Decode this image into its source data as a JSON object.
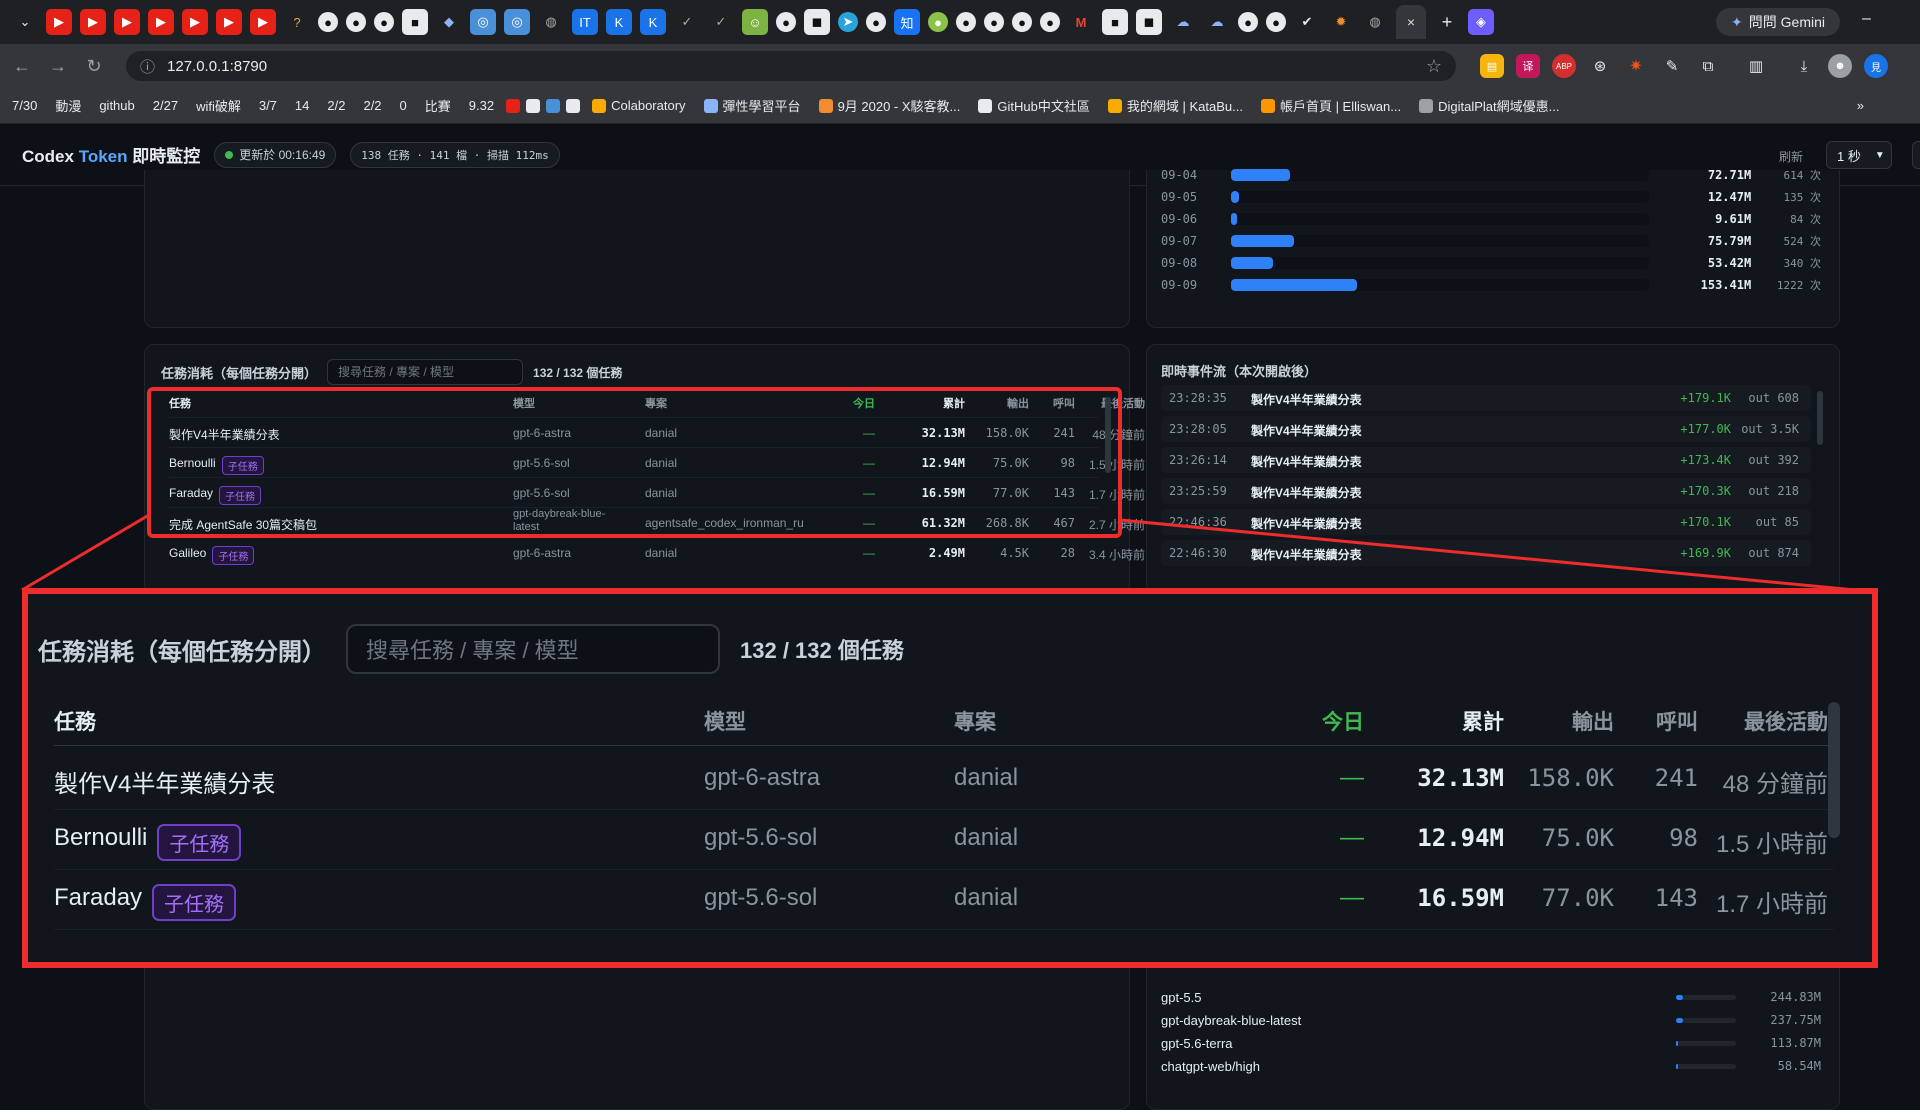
{
  "browser": {
    "url": "127.0.0.1:8790",
    "gemini_label": "問問 Gemini",
    "tab_close": "×",
    "new_tab": "+",
    "minimize": "–",
    "bookmarks": [
      "7/30",
      "動漫",
      "github",
      "2/27",
      "wifi破解",
      "3/7",
      "14",
      "2/2",
      "2/2",
      "0",
      "比賽",
      "9.32",
      "Colaboratory",
      "彈性學習平台",
      "9月 2020 - X駭客教...",
      "GitHub中文社區",
      "我的網域 | KataBu...",
      "帳戶首頁 | Elliswan...",
      "DigitalPlat網域優惠..."
    ],
    "bookmarks_more": "»"
  },
  "header": {
    "title_prefix": "Codex",
    "title_accent": "Token",
    "title_suffix": "即時監控",
    "updated": "更新於 00:16:49",
    "stats": "138 任務 · 141 檔 · 掃描 112ms",
    "refresh_label": "刷新",
    "refresh_value": "1 秒"
  },
  "daily": [
    {
      "date": "09-04",
      "value": "72.71M",
      "calls": "614 次",
      "frac": 0.14
    },
    {
      "date": "09-05",
      "value": "12.47M",
      "calls": "135 次",
      "frac": 0.02
    },
    {
      "date": "09-06",
      "value": "9.61M",
      "calls": "84 次",
      "frac": 0.015
    },
    {
      "date": "09-07",
      "value": "75.79M",
      "calls": "524 次",
      "frac": 0.15
    },
    {
      "date": "09-08",
      "value": "53.42M",
      "calls": "340 次",
      "frac": 0.1
    },
    {
      "date": "09-09",
      "value": "153.41M",
      "calls": "1222 次",
      "frac": 0.3
    }
  ],
  "tasks": {
    "title": "任務消耗（每個任務分開）",
    "search_placeholder": "搜尋任務 / 專案 / 模型",
    "count": "132 / 132 個任務",
    "headers": {
      "task": "任務",
      "model": "模型",
      "project": "專案",
      "today": "今日",
      "total": "累計",
      "output": "輸出",
      "calls": "呼叫",
      "last": "最後活動"
    },
    "rows": [
      {
        "task": "製作V4半年業績分表",
        "badge": "",
        "model": "gpt-6-astra",
        "project": "danial",
        "today": "—",
        "total": "32.13M",
        "output": "158.0K",
        "calls": "241",
        "last": "48 分鐘前"
      },
      {
        "task": "Bernoulli",
        "badge": "子任務",
        "model": "gpt-5.6-sol",
        "project": "danial",
        "today": "—",
        "total": "12.94M",
        "output": "75.0K",
        "calls": "98",
        "last": "1.5 小時前"
      },
      {
        "task": "Faraday",
        "badge": "子任務",
        "model": "gpt-5.6-sol",
        "project": "danial",
        "today": "—",
        "total": "16.59M",
        "output": "77.0K",
        "calls": "143",
        "last": "1.7 小時前"
      },
      {
        "task": "完成 AgentSafe 30篇交稿包",
        "badge": "",
        "model": "gpt-daybreak-blue-latest",
        "project": "agentsafe_codex_ironman_ru",
        "today": "—",
        "total": "61.32M",
        "output": "268.8K",
        "calls": "467",
        "last": "2.7 小時前"
      },
      {
        "task": "Galileo",
        "badge": "子任務",
        "model": "gpt-6-astra",
        "project": "danial",
        "today": "—",
        "total": "2.49M",
        "output": "4.5K",
        "calls": "28",
        "last": "3.4 小時前"
      }
    ]
  },
  "events": {
    "title": "即時事件流（本次開啟後）",
    "rows": [
      {
        "time": "23:28:35",
        "name": "製作V4半年業績分表",
        "delta": "+179.1K",
        "out": "out 608"
      },
      {
        "time": "23:28:05",
        "name": "製作V4半年業績分表",
        "delta": "+177.0K",
        "out": "out 3.5K"
      },
      {
        "time": "23:26:14",
        "name": "製作V4半年業績分表",
        "delta": "+173.4K",
        "out": "out 392"
      },
      {
        "time": "23:25:59",
        "name": "製作V4半年業績分表",
        "delta": "+170.3K",
        "out": "out 218"
      },
      {
        "time": "22:46:36",
        "name": "製作V4半年業績分表",
        "delta": "+170.1K",
        "out": "out 85"
      },
      {
        "time": "22:46:30",
        "name": "製作V4半年業績分表",
        "delta": "+169.9K",
        "out": "out 874"
      }
    ]
  },
  "models": [
    {
      "name": "gpt-5.5",
      "value": "244.83M",
      "frac": 0.12
    },
    {
      "name": "gpt-daybreak-blue-latest",
      "value": "237.75M",
      "frac": 0.11
    },
    {
      "name": "gpt-5.6-terra",
      "value": "113.87M",
      "frac": 0.03
    },
    {
      "name": "chatgpt-web/high",
      "value": "58.54M",
      "frac": 0.015
    }
  ]
}
